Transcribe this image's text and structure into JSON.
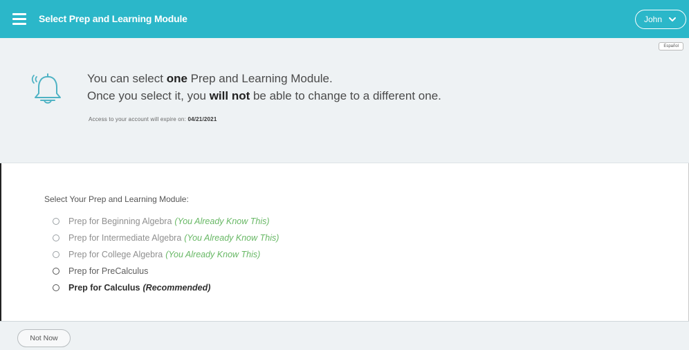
{
  "header": {
    "title": "Select Prep and Learning Module",
    "menu_icon": "hamburger-menu-icon",
    "user_label": "John",
    "user_chevron": "chevron-down-icon",
    "bar_color": "#2bb7c9"
  },
  "banner": {
    "language_button": "Español",
    "bell_icon": "bell-ringing-icon",
    "line1_pre": "You can select ",
    "line1_bold": "one",
    "line1_post": " Prep and Learning Module.",
    "line2_pre": "Once you select it, you ",
    "line2_bold": "will not",
    "line2_post": " be able to change to a different one.",
    "expire_label": "Access to your account will expire on:",
    "expire_date": "04/21/2021"
  },
  "modules": {
    "heading": "Select Your Prep and Learning Module:",
    "options": [
      {
        "label": "Prep for Beginning Algebra",
        "tag": "(You Already Know This)"
      },
      {
        "label": "Prep for Intermediate Algebra",
        "tag": "(You Already Know This)"
      },
      {
        "label": "Prep for College Algebra",
        "tag": "(You Already Know This)"
      },
      {
        "label": "Prep for PreCalculus",
        "tag": ""
      },
      {
        "label": "Prep for Calculus",
        "tag": "(Recommended)"
      }
    ],
    "tag_color": "#68b865"
  },
  "footer": {
    "not_now_label": "Not Now"
  }
}
